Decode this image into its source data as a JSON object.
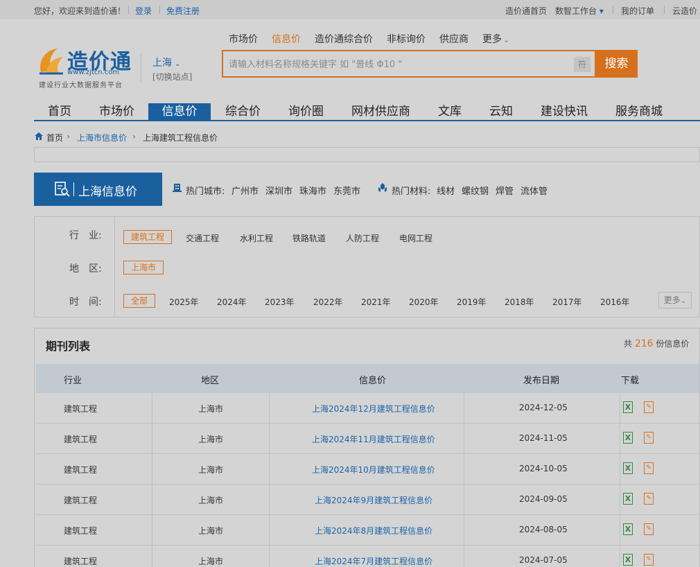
{
  "topbar": {
    "greeting": "您好，欢迎来到造价通！",
    "login": "登录",
    "register": "免费注册",
    "home_link": "造价通首页",
    "workbench": "数智工作台",
    "workbench_arrow": "▾",
    "orders": "我的订单",
    "cloud": "云造价"
  },
  "logo": {
    "title": "造价通",
    "url": "www.zjtcn.com",
    "slogan": "建设行业大数据服务平台"
  },
  "location": {
    "city": "上海",
    "chevron": "⌄",
    "switch": "[切换站点]"
  },
  "subnav": [
    "市场价",
    "信息价",
    "造价通综合价",
    "非标询价",
    "供应商",
    "更多"
  ],
  "subnav_more_arrow": "⌄",
  "search": {
    "placeholder": "请输入材料名称规格关键字 如 \"普线 Φ10 \"",
    "symbol_btn": "符",
    "button": "搜索"
  },
  "mainnav": [
    "首页",
    "市场价",
    "信息价",
    "综合价",
    "询价圈",
    "网材供应商",
    "文库",
    "云知",
    "建设快讯",
    "服务商城"
  ],
  "breadcrumb": [
    "首页",
    "上海市信息价",
    "上海建筑工程信息价"
  ],
  "breadcrumb_sep": "›",
  "info_bar": {
    "label": "上海信息价",
    "hot_cities_label": "热门城市:",
    "hot_cities": [
      "广州市",
      "深圳市",
      "珠海市",
      "东莞市"
    ],
    "hot_materials_label": "热门材料:",
    "hot_materials": [
      "线材",
      "螺纹钢",
      "焊管",
      "流体管"
    ]
  },
  "filter": {
    "industry_label": "行　业:",
    "industries": [
      "建筑工程",
      "交通工程",
      "水利工程",
      "铁路轨道",
      "人防工程",
      "电网工程"
    ],
    "region_label": "地　区:",
    "regions": [
      "上海市"
    ],
    "time_label": "时　间:",
    "times": [
      "全部",
      "2025年",
      "2024年",
      "2023年",
      "2022年",
      "2021年",
      "2020年",
      "2019年",
      "2018年",
      "2017年",
      "2016年"
    ],
    "more": "更多"
  },
  "list": {
    "title": "期刊列表",
    "total_prefix": "共",
    "total": "216",
    "total_suffix": "份信息价",
    "headers": [
      "行业",
      "地区",
      "信息价",
      "发布日期",
      "下载"
    ],
    "rows": [
      {
        "industry": "建筑工程",
        "region": "上海市",
        "title": "上海2024年12月建筑工程信息价",
        "date": "2024-12-05"
      },
      {
        "industry": "建筑工程",
        "region": "上海市",
        "title": "上海2024年11月建筑工程信息价",
        "date": "2024-11-05"
      },
      {
        "industry": "建筑工程",
        "region": "上海市",
        "title": "上海2024年10月建筑工程信息价",
        "date": "2024-10-05"
      },
      {
        "industry": "建筑工程",
        "region": "上海市",
        "title": "上海2024年9月建筑工程信息价",
        "date": "2024-09-05"
      },
      {
        "industry": "建筑工程",
        "region": "上海市",
        "title": "上海2024年8月建筑工程信息价",
        "date": "2024-08-05"
      },
      {
        "industry": "建筑工程",
        "region": "上海市",
        "title": "上海2024年7月建筑工程信息价",
        "date": "2024-07-05"
      }
    ]
  },
  "colors": {
    "brand_blue": "#1a5f9e",
    "accent_orange": "#d6701e",
    "excel_green": "#2f8a3c"
  }
}
